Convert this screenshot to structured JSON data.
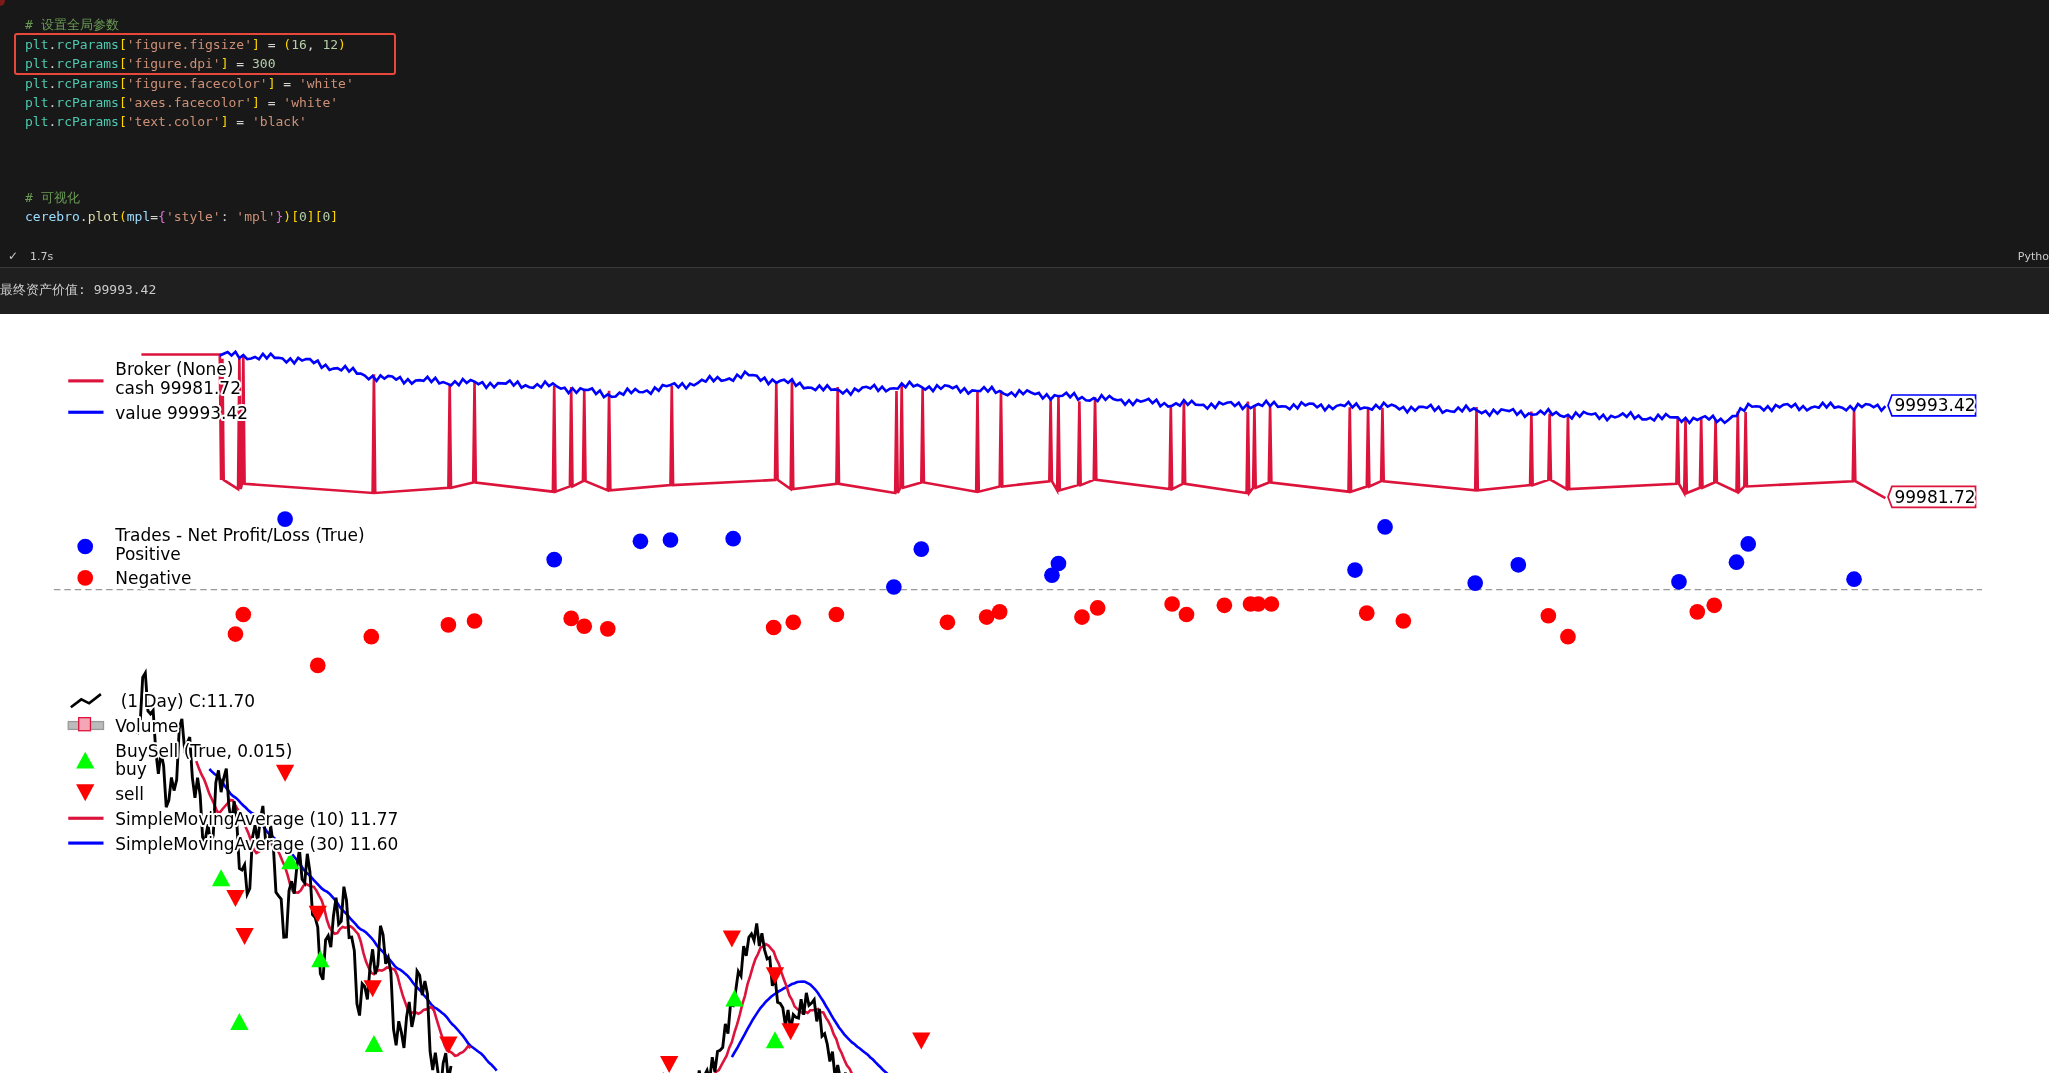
{
  "code_cell": {
    "lines": [
      {
        "boxed": false,
        "tokens": [
          {
            "kind": "comment",
            "text": "# 设置全局参数"
          }
        ]
      },
      {
        "boxed": true,
        "tokens": [
          {
            "kind": "var",
            "text": "plt"
          },
          {
            "kind": "plain",
            "text": "."
          },
          {
            "kind": "var",
            "text": "rcParams"
          },
          {
            "kind": "bracket",
            "text": "["
          },
          {
            "kind": "string",
            "text": "'figure.figsize'"
          },
          {
            "kind": "bracket",
            "text": "]"
          },
          {
            "kind": "plain",
            "text": " = "
          },
          {
            "kind": "bracket",
            "text": "("
          },
          {
            "kind": "number",
            "text": "16"
          },
          {
            "kind": "plain",
            "text": ", "
          },
          {
            "kind": "number",
            "text": "12"
          },
          {
            "kind": "bracket",
            "text": ")"
          }
        ]
      },
      {
        "boxed": true,
        "tokens": [
          {
            "kind": "var",
            "text": "plt"
          },
          {
            "kind": "plain",
            "text": "."
          },
          {
            "kind": "var",
            "text": "rcParams"
          },
          {
            "kind": "bracket",
            "text": "["
          },
          {
            "kind": "string",
            "text": "'figure.dpi'"
          },
          {
            "kind": "bracket",
            "text": "]"
          },
          {
            "kind": "plain",
            "text": " = "
          },
          {
            "kind": "number",
            "text": "300"
          }
        ]
      },
      {
        "boxed": false,
        "tokens": [
          {
            "kind": "var",
            "text": "plt"
          },
          {
            "kind": "plain",
            "text": "."
          },
          {
            "kind": "var",
            "text": "rcParams"
          },
          {
            "kind": "bracket",
            "text": "["
          },
          {
            "kind": "string",
            "text": "'figure.facecolor'"
          },
          {
            "kind": "bracket",
            "text": "]"
          },
          {
            "kind": "plain",
            "text": " = "
          },
          {
            "kind": "string",
            "text": "'white'"
          }
        ]
      },
      {
        "boxed": false,
        "tokens": [
          {
            "kind": "var",
            "text": "plt"
          },
          {
            "kind": "plain",
            "text": "."
          },
          {
            "kind": "var",
            "text": "rcParams"
          },
          {
            "kind": "bracket",
            "text": "["
          },
          {
            "kind": "string",
            "text": "'axes.facecolor'"
          },
          {
            "kind": "bracket",
            "text": "]"
          },
          {
            "kind": "plain",
            "text": " = "
          },
          {
            "kind": "string",
            "text": "'white'"
          }
        ]
      },
      {
        "boxed": false,
        "tokens": [
          {
            "kind": "var",
            "text": "plt"
          },
          {
            "kind": "plain",
            "text": "."
          },
          {
            "kind": "var",
            "text": "rcParams"
          },
          {
            "kind": "bracket",
            "text": "["
          },
          {
            "kind": "string",
            "text": "'text.color'"
          },
          {
            "kind": "bracket",
            "text": "]"
          },
          {
            "kind": "plain",
            "text": " = "
          },
          {
            "kind": "string",
            "text": "'black'"
          }
        ]
      },
      {
        "boxed": false,
        "tokens": [
          {
            "kind": "comment",
            "text": "# 可视化"
          }
        ]
      },
      {
        "boxed": false,
        "tokens": [
          {
            "kind": "name",
            "text": "cerebro"
          },
          {
            "kind": "plain",
            "text": "."
          },
          {
            "kind": "func",
            "text": "plot"
          },
          {
            "kind": "bracket",
            "text": "("
          },
          {
            "kind": "param",
            "text": "mpl"
          },
          {
            "kind": "plain",
            "text": "="
          },
          {
            "kind": "brace",
            "text": "{"
          },
          {
            "kind": "string",
            "text": "'style'"
          },
          {
            "kind": "plain",
            "text": ": "
          },
          {
            "kind": "string",
            "text": "'mpl'"
          },
          {
            "kind": "brace",
            "text": "}"
          },
          {
            "kind": "bracket",
            "text": ")"
          },
          {
            "kind": "brace2",
            "text": "["
          },
          {
            "kind": "number",
            "text": "0"
          },
          {
            "kind": "brace2",
            "text": "]"
          },
          {
            "kind": "brace2",
            "text": "["
          },
          {
            "kind": "number",
            "text": "0"
          },
          {
            "kind": "brace2",
            "text": "]"
          }
        ]
      }
    ],
    "status": {
      "check": "✓",
      "duration": "1.7s",
      "language": "Pytho"
    }
  },
  "output": {
    "text": "最终资产价值: 99993.42"
  },
  "plot": {
    "broker_legend": {
      "title": "Broker (None)",
      "entries": [
        {
          "label": "cash 99981.72",
          "color": "#dc143c"
        },
        {
          "label": "value 99993.42",
          "color": "#0000ff"
        }
      ]
    },
    "value_tags": [
      {
        "text": "99993.42",
        "color": "#0000ff"
      },
      {
        "text": "99981.72",
        "color": "#dc143c"
      }
    ],
    "trades_legend": {
      "title": "Trades - Net Profit/Loss (True)",
      "entries": [
        {
          "label": "Positive",
          "color": "#0000ff"
        },
        {
          "label": "Negative",
          "color": "#ff0000"
        }
      ]
    },
    "data_legend": [
      {
        "kind": "price",
        "label": " (1 Day) C:11.70"
      },
      {
        "kind": "volume",
        "label": "Volume"
      },
      {
        "kind": "header",
        "label": "BuySell (True, 0.015)"
      },
      {
        "kind": "buy",
        "label": "buy",
        "color": "#00ff00"
      },
      {
        "kind": "sell",
        "label": "sell",
        "color": "#ff0000"
      },
      {
        "kind": "line",
        "label": "SimpleMovingAverage (10) 11.77",
        "color": "#dc143c"
      },
      {
        "kind": "line",
        "label": "SimpleMovingAverage (30) 11.60",
        "color": "#0000ff"
      }
    ]
  }
}
